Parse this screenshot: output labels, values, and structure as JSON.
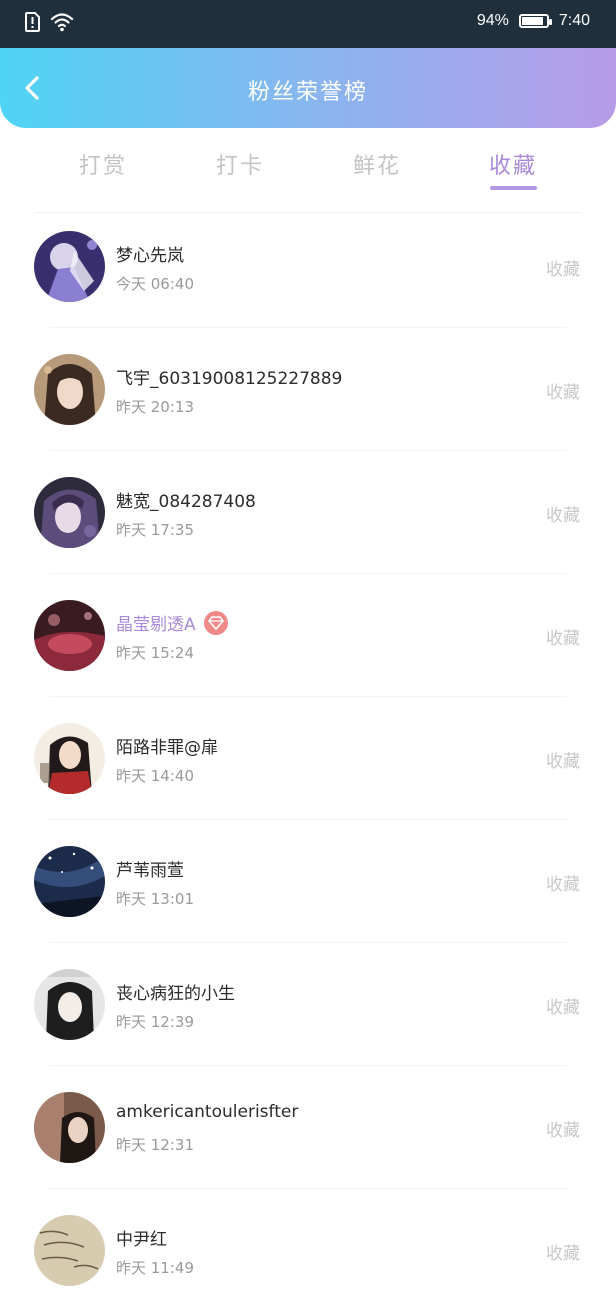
{
  "status_bar": {
    "battery_percent": "94%",
    "battery_level": 0.94,
    "time": "7:40",
    "icons": [
      "sim-alert-icon",
      "wifi-icon",
      "battery-icon"
    ]
  },
  "header": {
    "title": "粉丝荣誉榜",
    "back_icon": "chevron-left-icon",
    "gradient": [
      "#4fd4f5",
      "#b79be8"
    ]
  },
  "tabs": [
    {
      "label": "打赏",
      "active": false
    },
    {
      "label": "打卡",
      "active": false
    },
    {
      "label": "鲜花",
      "active": false
    },
    {
      "label": "收藏",
      "active": true
    }
  ],
  "colors": {
    "accent": "#a98ad9",
    "vip_badge": "#f08a8a",
    "muted_text": "#c8c8c8"
  },
  "fans": [
    {
      "name": "梦心先岚",
      "time": "今天 06:40",
      "action": "收藏",
      "vip": false
    },
    {
      "name": "飞宇_60319008125227889",
      "time": "昨天 20:13",
      "action": "收藏",
      "vip": false
    },
    {
      "name": "魅宽_084287408",
      "time": "昨天 17:35",
      "action": "收藏",
      "vip": false
    },
    {
      "name": "晶莹剔透A",
      "time": "昨天 15:24",
      "action": "收藏",
      "vip": true,
      "badge_icon": "diamond-icon"
    },
    {
      "name": "陌路非罪@扉",
      "time": "昨天 14:40",
      "action": "收藏",
      "vip": false
    },
    {
      "name": "芦苇雨萱",
      "time": "昨天 13:01",
      "action": "收藏",
      "vip": false
    },
    {
      "name": "丧心病狂的小生",
      "time": "昨天 12:39",
      "action": "收藏",
      "vip": false
    },
    {
      "name": "amkericantoulerisfter",
      "time": "昨天 12:31",
      "action": "收藏",
      "vip": false
    },
    {
      "name": "中尹红",
      "time": "昨天 11:49",
      "action": "收藏",
      "vip": false
    }
  ]
}
